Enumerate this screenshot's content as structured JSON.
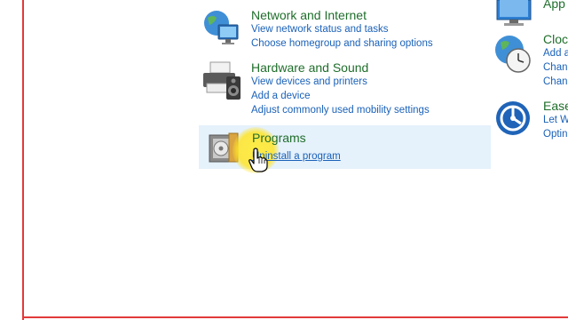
{
  "categories": {
    "network": {
      "title": "Network and Internet",
      "links": [
        "View network status and tasks",
        "Choose homegroup and sharing options"
      ]
    },
    "hardware": {
      "title": "Hardware and Sound",
      "links": [
        "View devices and printers",
        "Add a device",
        "Adjust commonly used mobility settings"
      ]
    },
    "programs": {
      "title": "Programs",
      "links": [
        "Uninstall a program"
      ]
    }
  },
  "right_column": {
    "appearance_title": "App",
    "clock": {
      "title": "Cloc",
      "links": [
        "Add a",
        "Chang",
        "Chang"
      ]
    },
    "ease": {
      "title": "Ease",
      "links": [
        "Let W",
        "Optin"
      ]
    }
  },
  "colors": {
    "title_green": "#1f6e2b",
    "link_blue": "#1a61b8",
    "highlight": "#e5f1fb",
    "window_border": "#e23a3a"
  }
}
